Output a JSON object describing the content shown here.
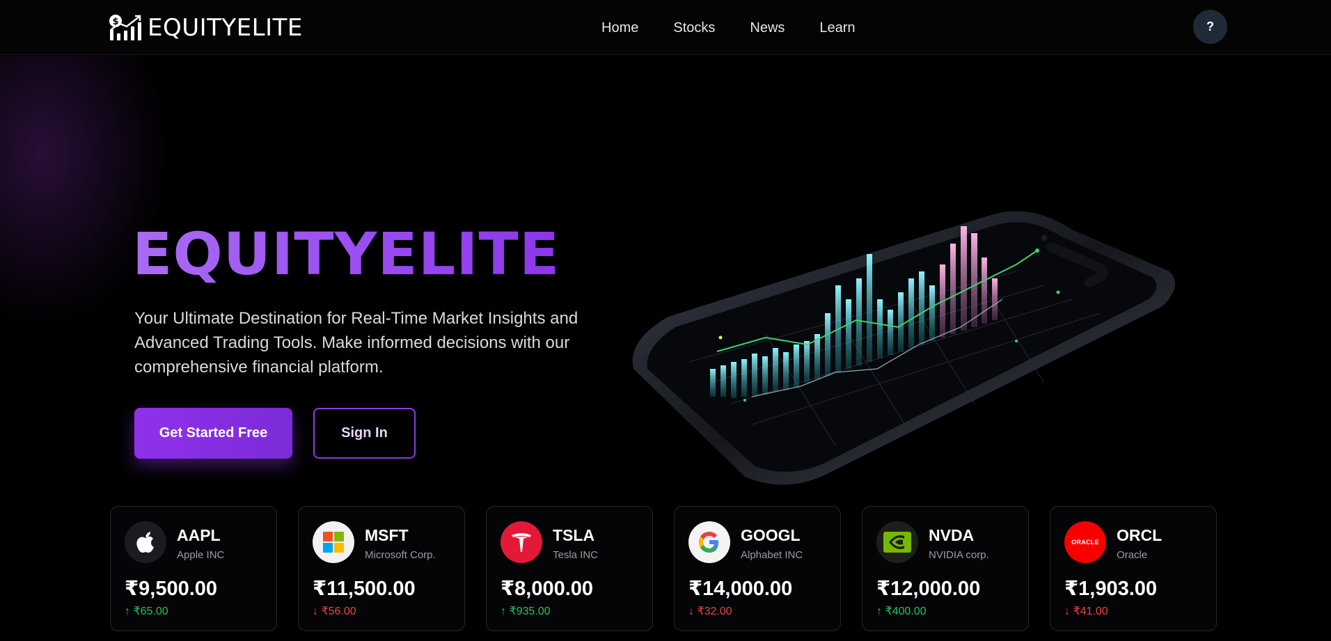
{
  "nav": {
    "brand": "EQUITYELITE",
    "links": [
      "Home",
      "Stocks",
      "News",
      "Learn"
    ],
    "help_label": "?"
  },
  "hero": {
    "title": "EQUITYELITE",
    "subtitle": "Your Ultimate Destination for Real-Time Market Insights and Advanced Trading Tools. Make informed decisions with our comprehensive financial platform.",
    "primary_button": "Get Started Free",
    "secondary_button": "Sign In"
  },
  "colors": {
    "accent": "#8b36ea",
    "up": "#22c55e",
    "down": "#ef4444"
  },
  "stocks": [
    {
      "ticker": "AAPL",
      "name": "Apple INC",
      "price": "₹9,500.00",
      "change": "↑ ₹65.00",
      "direction": "up",
      "icon": "apple-logo-icon"
    },
    {
      "ticker": "MSFT",
      "name": "Microsoft Corp.",
      "price": "₹11,500.00",
      "change": "↓ ₹56.00",
      "direction": "down",
      "icon": "microsoft-logo-icon"
    },
    {
      "ticker": "TSLA",
      "name": "Tesla INC",
      "price": "₹8,000.00",
      "change": "↑ ₹935.00",
      "direction": "up",
      "icon": "tesla-logo-icon"
    },
    {
      "ticker": "GOOGL",
      "name": "Alphabet INC",
      "price": "₹14,000.00",
      "change": "↓ ₹32.00",
      "direction": "down",
      "icon": "google-logo-icon"
    },
    {
      "ticker": "NVDA",
      "name": "NVIDIA corp.",
      "price": "₹12,000.00",
      "change": "↑ ₹400.00",
      "direction": "up",
      "icon": "nvidia-logo-icon"
    },
    {
      "ticker": "ORCL",
      "name": "Oracle",
      "price": "₹1,903.00",
      "change": "↓ ₹41.00",
      "direction": "down",
      "icon": "oracle-logo-icon",
      "logo_text": "ORACLE"
    }
  ]
}
